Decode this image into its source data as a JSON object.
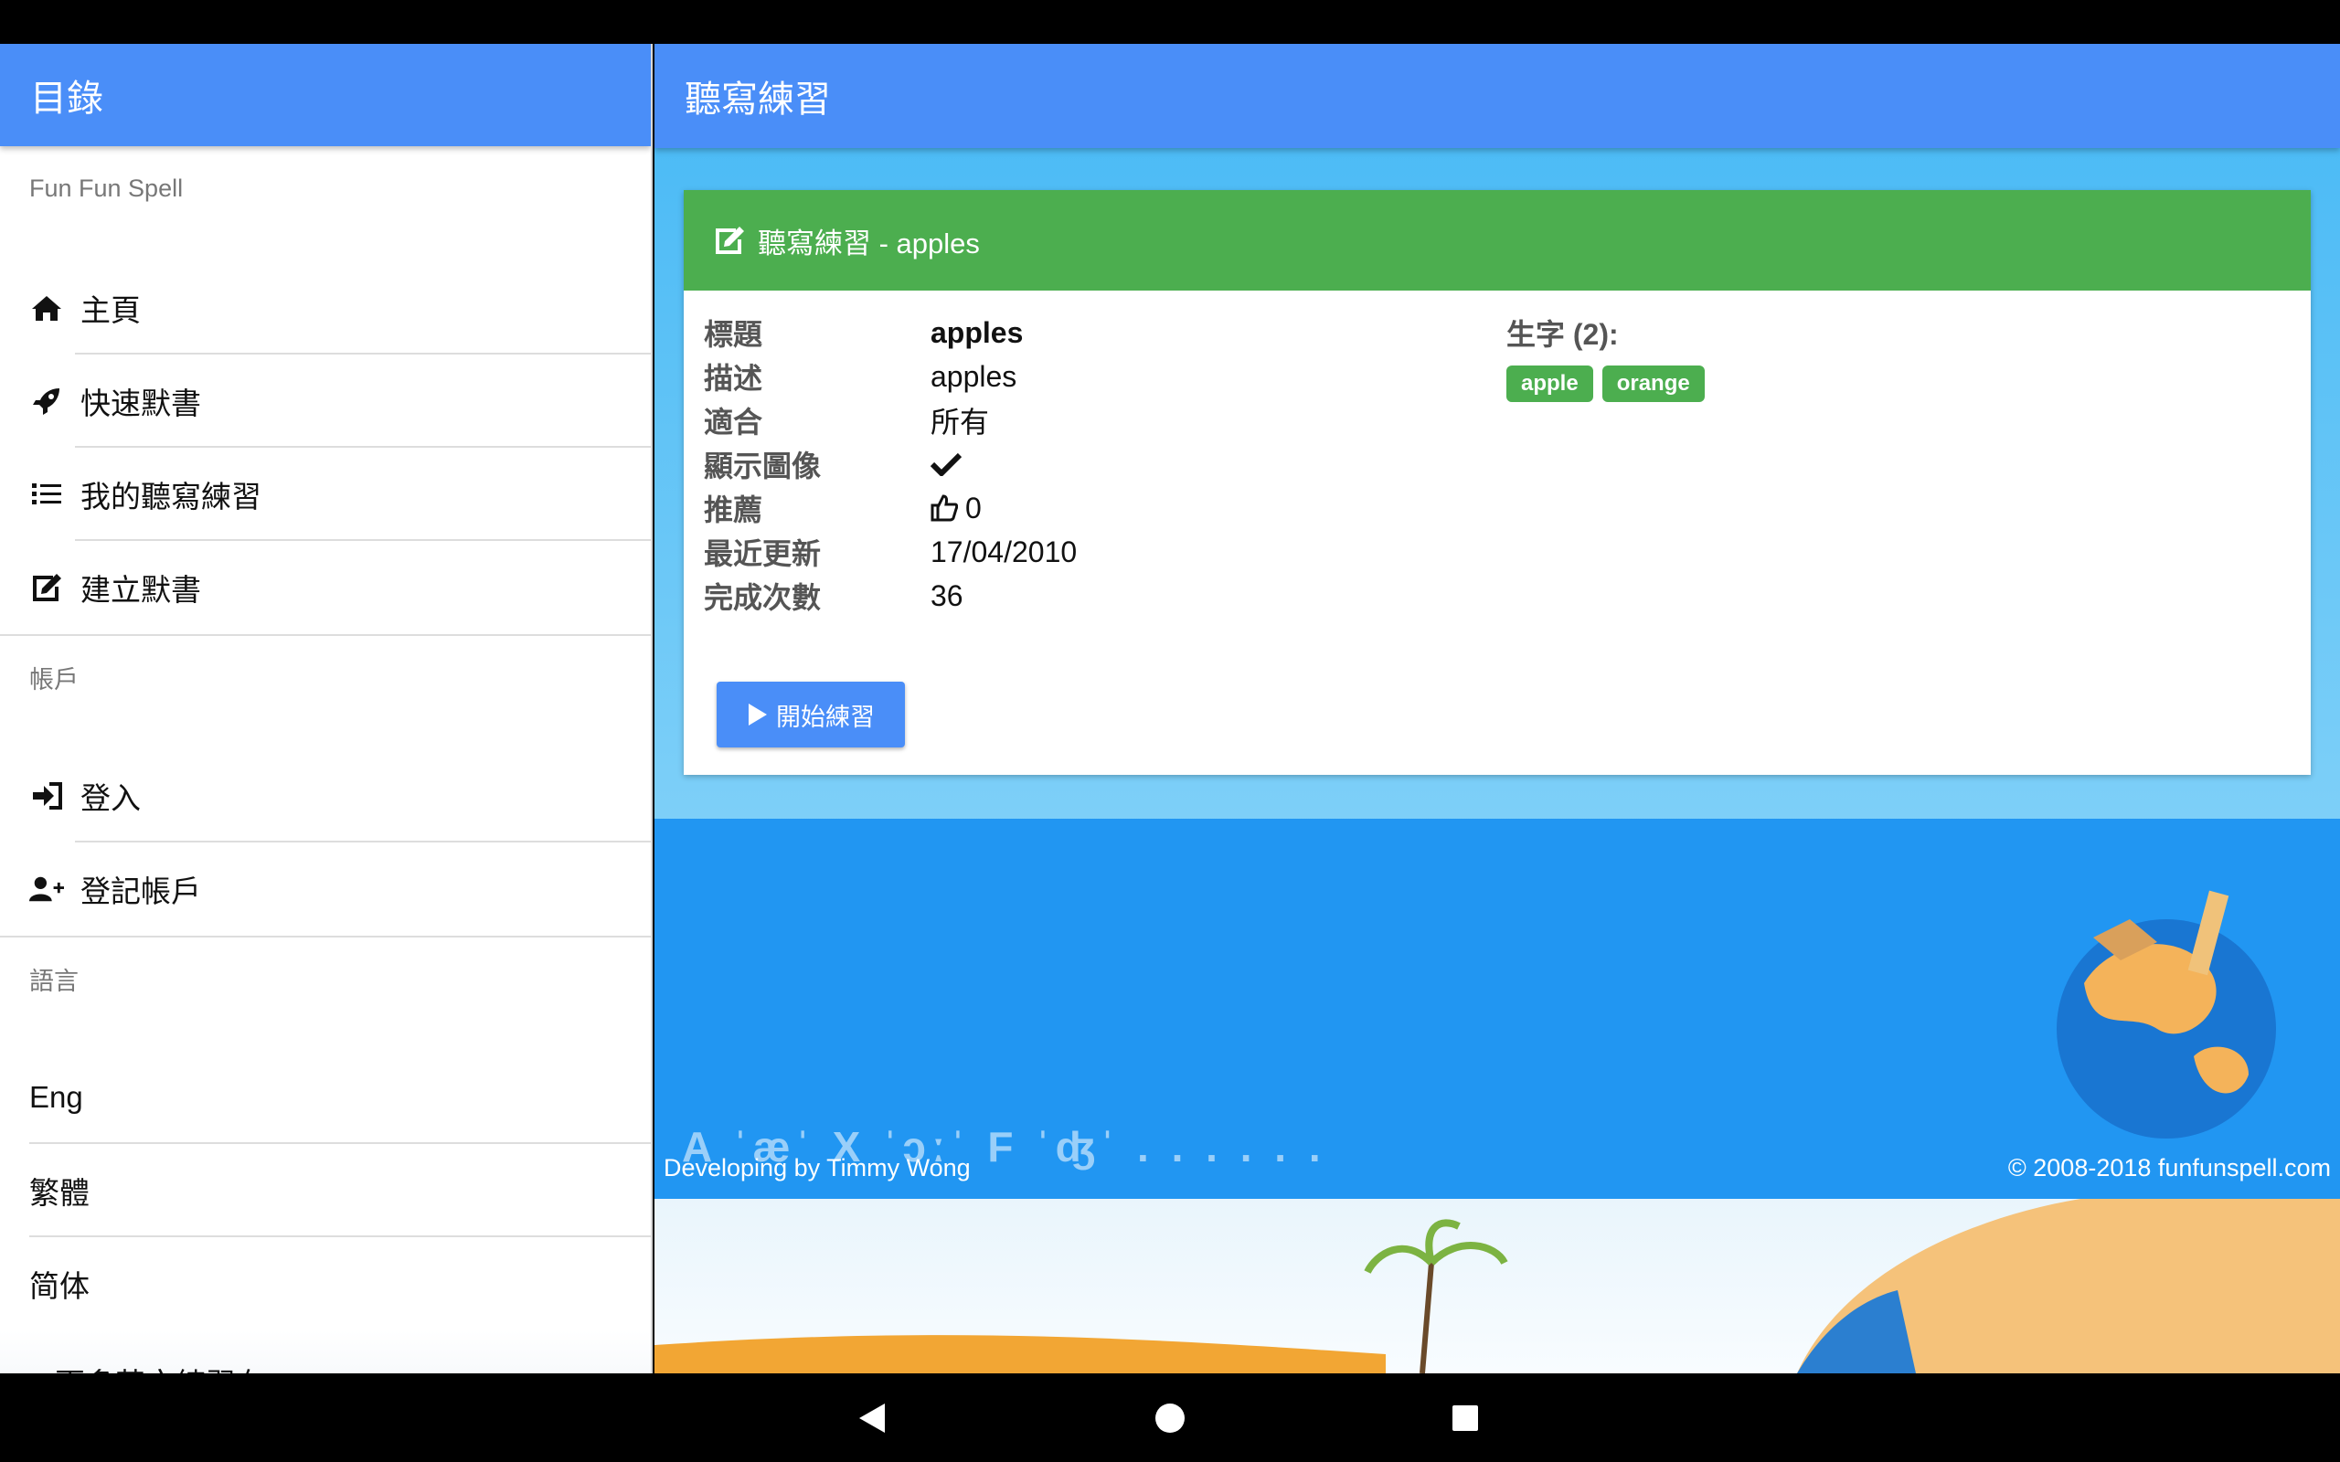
{
  "sidebar": {
    "title": "目錄",
    "brand": "Fun Fun Spell",
    "nav_items": [
      {
        "label": "主頁",
        "icon": "home-icon"
      },
      {
        "label": "快速默書",
        "icon": "rocket-icon"
      },
      {
        "label": "我的聽寫練習",
        "icon": "list-icon"
      },
      {
        "label": "建立默書",
        "icon": "edit-icon"
      }
    ],
    "account_label": "帳戶",
    "account_items": [
      {
        "label": "登入",
        "icon": "sign-in-icon"
      },
      {
        "label": "登記帳戶",
        "icon": "user-plus-icon"
      }
    ],
    "language_label": "語言",
    "languages": [
      "Eng",
      "繁體",
      "简体"
    ],
    "more_text": "更多英文練習在"
  },
  "main": {
    "title": "聽寫練習",
    "card_title": "聽寫練習 - apples",
    "fields": [
      {
        "label": "標題",
        "value": "apples"
      },
      {
        "label": "描述",
        "value": "apples"
      },
      {
        "label": "適合",
        "value": "所有"
      },
      {
        "label": "顯示圖像",
        "value": ""
      },
      {
        "label": "推薦",
        "value": "0"
      },
      {
        "label": "最近更新",
        "value": "17/04/2010"
      },
      {
        "label": "完成次數",
        "value": "36"
      }
    ],
    "words_title": "生字 (2):",
    "words": [
      "apple",
      "orange"
    ],
    "start_button": "開始練習"
  },
  "footer": {
    "phonetics": "A ˈæˈ X ˈɔːˈ F ˈʤˈ . . . . . .",
    "developer": "Developing by Timmy Wong",
    "copyright": "© 2008-2018 funfunspell.com"
  },
  "colors": {
    "header_blue": "#4a8ef8",
    "card_green": "#4cae4f",
    "footer_blue": "#2196f2"
  }
}
